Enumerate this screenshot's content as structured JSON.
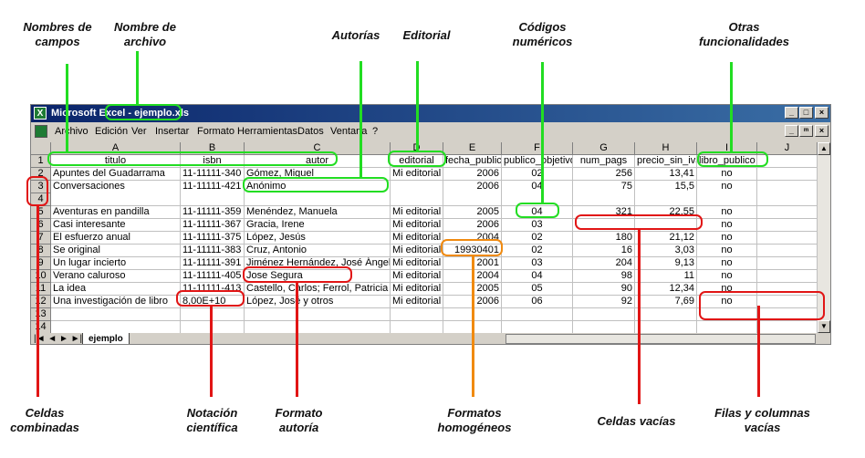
{
  "annotations": {
    "nombres_campos": "Nombres de\ncampos",
    "nombre_archivo": "Nombre de\narchivo",
    "autorias": "Autorías",
    "editorial": "Editorial",
    "codigos": "Códigos\nnuméricos",
    "otras": "Otras\nfuncionalidades",
    "celdas_combinadas": "Celdas\ncombinadas",
    "notacion": "Notación\ncientífica",
    "formato_autoria": "Formato\nautoría",
    "formatos_homogeneos": "Formatos\nhomogéneos",
    "celdas_vacias": "Celdas vacías",
    "filas_columnas": "Filas y columnas\nvacías"
  },
  "window": {
    "title": "Microsoft Excel - ejemplo.xls",
    "icon": "excel-icon"
  },
  "menu": [
    "Archivo",
    "Edición",
    "Ver",
    "Insertar",
    "Formato",
    "Herramientas",
    "Datos",
    "Ventana",
    "?"
  ],
  "columns": [
    "A",
    "B",
    "C",
    "D",
    "E",
    "F",
    "G",
    "H",
    "I",
    "J"
  ],
  "row_numbers": [
    "1",
    "2",
    "3",
    "4",
    "5",
    "6",
    "7",
    "8",
    "9",
    "10",
    "11",
    "12",
    "13",
    "14"
  ],
  "header_row": [
    "titulo",
    "isbn",
    "autor",
    "editorial",
    "fecha_public",
    "publico_objetivo",
    "num_pags",
    "precio_sin_iva",
    "libro_publico",
    ""
  ],
  "rows": [
    [
      "Apuntes del Guadarrama",
      "11-11111-340",
      "Gómez, Miguel",
      "Mi editorial",
      "2006",
      "02",
      "256",
      "13,41",
      "no",
      ""
    ],
    [
      "Conversaciones",
      "11-11111-421",
      "Anónimo",
      "",
      "2006",
      "04",
      "75",
      "15,5",
      "no",
      ""
    ],
    [
      "Aventuras en pandilla",
      "11-11111-359",
      "Menéndez, Manuela",
      "Mi editorial",
      "2005",
      "04",
      "321",
      "22,55",
      "no",
      ""
    ],
    [
      "Casi interesante",
      "11-11111-367",
      "Gracia, Irene",
      "Mi editorial",
      "2006",
      "03",
      "",
      "",
      "no",
      ""
    ],
    [
      "El esfuerzo anual",
      "11-11111-375",
      "López, Jesús",
      "Mi editorial",
      "2004",
      "02",
      "180",
      "21,12",
      "no",
      ""
    ],
    [
      "Se original",
      "11-11111-383",
      "Cruz, Antonio",
      "Mi editorial",
      "19930401",
      "02",
      "16",
      "3,03",
      "no",
      ""
    ],
    [
      "Un lugar incierto",
      "11-11111-391",
      "Jiménez Hernández, José Ángel",
      "Mi editorial",
      "2001",
      "03",
      "204",
      "9,13",
      "no",
      ""
    ],
    [
      "Verano caluroso",
      "11-11111-405",
      "Jose Segura",
      "Mi editorial",
      "2004",
      "04",
      "98",
      "11",
      "no",
      ""
    ],
    [
      "La idea",
      "11-11111-413",
      "Castello, Carlos; Ferrol, Patricia",
      "Mi editorial",
      "2005",
      "05",
      "90",
      "12,34",
      "no",
      ""
    ],
    [
      "Una investigación de libro",
      "8,00E+10",
      "López, José y otros",
      "Mi editorial",
      "2006",
      "06",
      "92",
      "7,69",
      "no",
      ""
    ]
  ],
  "sheet_tab": "ejemplo"
}
